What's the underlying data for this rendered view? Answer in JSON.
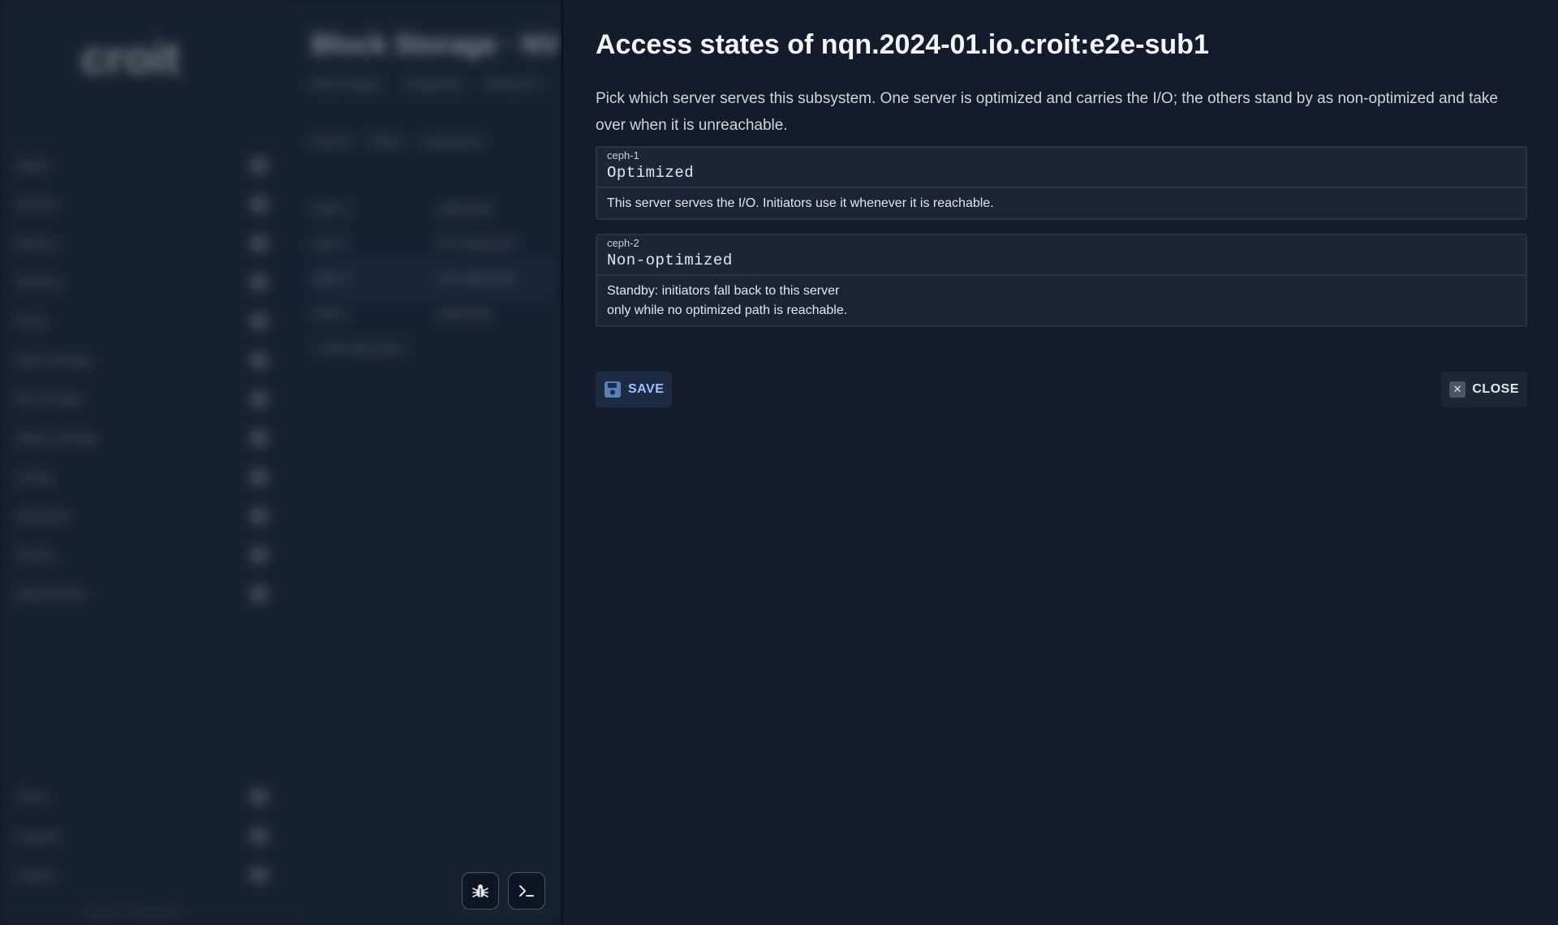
{
  "background": {
    "logo": "croit",
    "nav_items": [
      "Status",
      "Servers",
      "Metrics",
      "Services",
      "Pools",
      "Block Storage",
      "File Storage",
      "Object Storage",
      "Config",
      "Hardware",
      "History",
      "Maintenance"
    ],
    "nav_bottom": [
      "Tasks",
      "Support",
      "Logout"
    ],
    "version": "v2507.0.1234abcd",
    "title": "Block Storage · NVMe",
    "tabs": [
      "RBD Images",
      "Snapshots",
      "NVMe-oF"
    ],
    "filters": [
      "Search",
      "Filters",
      "Subsystem"
    ],
    "rows": [
      "ceph-1",
      "ceph-2",
      "ceph-3",
      "ceph-4"
    ],
    "rows_col2": [
      "optimized",
      "non-optimized",
      "non-optimized",
      "optimized"
    ],
    "add_label": "+ Add subsystem"
  },
  "drawer": {
    "title": "Access states of nqn.2024-01.io.croit:e2e-sub1",
    "description": "Pick which server serves this subsystem. One server is optimized and carries the I/O; the others stand by as non-optimized and take over when it is unreachable.",
    "states": [
      {
        "server": "ceph-1",
        "value": "Optimized",
        "help_lines": [
          "This server serves the I/O. Initiators use it whenever it is reachable."
        ]
      },
      {
        "server": "ceph-2",
        "value": "Non-optimized",
        "help_lines": [
          "Standby: initiators fall back to this server",
          "only while no optimized path is reachable."
        ]
      }
    ],
    "save_label": "SAVE",
    "close_label": "CLOSE"
  },
  "colors": {
    "drawer_bg": "#141b2b",
    "save_accent": "#9ec1ff",
    "card_border": "#2a3345"
  },
  "icons": {
    "save": "floppy-disk-icon",
    "close": "close-icon",
    "debug": "bug-icon",
    "terminal": "terminal-icon"
  }
}
